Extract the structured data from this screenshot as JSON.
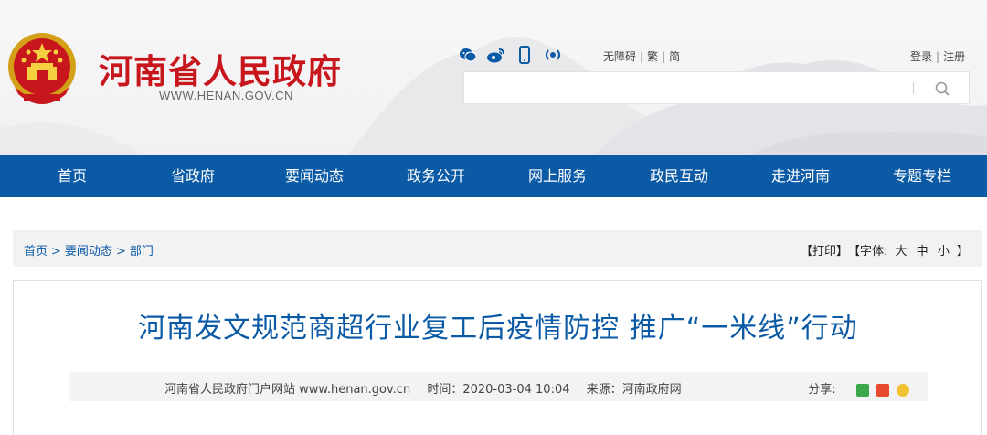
{
  "header": {
    "site_name": "河南省人民政府",
    "site_url": "WWW.HENAN.GOV.CN",
    "social_icons": [
      "wechat-icon",
      "weibo-icon",
      "mobile-icon",
      "broadcast-icon"
    ],
    "accessibility": {
      "barrier_free": "无障碍",
      "traditional": "繁",
      "simplified": "简"
    },
    "account": {
      "login": "登录",
      "register": "注册"
    },
    "search": {
      "placeholder": "",
      "icon": "search-icon"
    }
  },
  "nav": {
    "items": [
      "首页",
      "省政府",
      "要闻动态",
      "政务公开",
      "网上服务",
      "政民互动",
      "走进河南",
      "专题专栏"
    ]
  },
  "breadcrumb": {
    "items": [
      "首页",
      "要闻动态",
      "部门"
    ]
  },
  "tools": {
    "print": "【打印】",
    "font_label": "【字体:",
    "large": "大",
    "medium": "中",
    "small": "小",
    "close": "】"
  },
  "article": {
    "title": "河南发文规范商超行业复工后疫情防控 推广“一米线”行动",
    "source_site": "河南省人民政府门户网站 www.henan.gov.cn",
    "time": "时间：2020-03-04 10:04",
    "origin": "来源：河南政府网",
    "share_label": "分享:"
  },
  "colors": {
    "brand_red": "#c8161d",
    "nav_blue": "#0b5aa5",
    "title_blue": "#0b5aa5"
  }
}
